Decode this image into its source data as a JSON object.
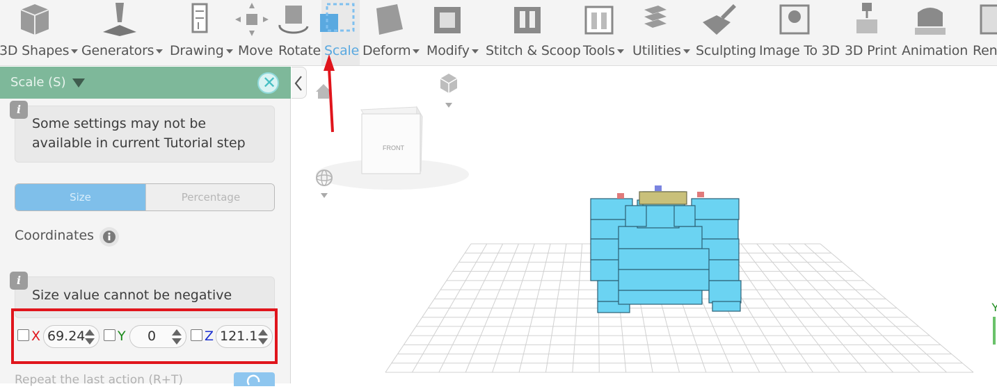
{
  "toolbar": {
    "items": [
      {
        "label": "3D Shapes",
        "dropdown": true,
        "icon": "cube-icon"
      },
      {
        "label": "Generators",
        "dropdown": true,
        "icon": "generator-icon"
      },
      {
        "label": "Drawing",
        "dropdown": true,
        "icon": "drawing-icon"
      },
      {
        "label": "Move",
        "dropdown": false,
        "icon": "move-icon"
      },
      {
        "label": "Rotate",
        "dropdown": false,
        "icon": "rotate-icon"
      },
      {
        "label": "Scale",
        "dropdown": false,
        "icon": "scale-icon",
        "active": true
      },
      {
        "label": "Deform",
        "dropdown": true,
        "icon": "deform-icon"
      },
      {
        "label": "Modify",
        "dropdown": true,
        "icon": "modify-icon"
      },
      {
        "label": "Stitch & Scoop",
        "dropdown": false,
        "icon": "stitch-scoop-icon"
      },
      {
        "label": "Tools",
        "dropdown": true,
        "icon": "tools-icon"
      },
      {
        "label": "Utilities",
        "dropdown": true,
        "icon": "utilities-icon"
      },
      {
        "label": "Sculpting",
        "dropdown": false,
        "icon": "sculpting-icon"
      },
      {
        "label": "Image To 3D",
        "dropdown": false,
        "icon": "image-to-3d-icon"
      },
      {
        "label": "3D Print",
        "dropdown": false,
        "icon": "3d-print-icon"
      },
      {
        "label": "Animation",
        "dropdown": false,
        "icon": "animation-icon"
      },
      {
        "label": "Render",
        "dropdown": false,
        "icon": "render-icon"
      }
    ]
  },
  "panel": {
    "title": "Scale (S)",
    "notice": {
      "line1": "Some settings may not be",
      "line2": "available in current Tutorial step"
    },
    "segment": {
      "size": "Size",
      "percentage": "Percentage",
      "selected": "Size"
    },
    "coordinates_label": "Coordinates",
    "warning": "Size value cannot be negative",
    "fields": {
      "x": {
        "label": "X",
        "value": "69.24",
        "color": "#e0151c"
      },
      "y": {
        "label": "Y",
        "value": "0",
        "color": "#1a8a1a"
      },
      "z": {
        "label": "Z",
        "value": "121.1",
        "color": "#1a2fd0"
      }
    },
    "repeat_label": "Repeat the last action (R+T)"
  },
  "viewport": {
    "view_cube_face": "FRONT",
    "model": "tank",
    "model_color": "#6bd3f2",
    "axis_label_y": "Y"
  },
  "annotation_color": "#e0151c"
}
